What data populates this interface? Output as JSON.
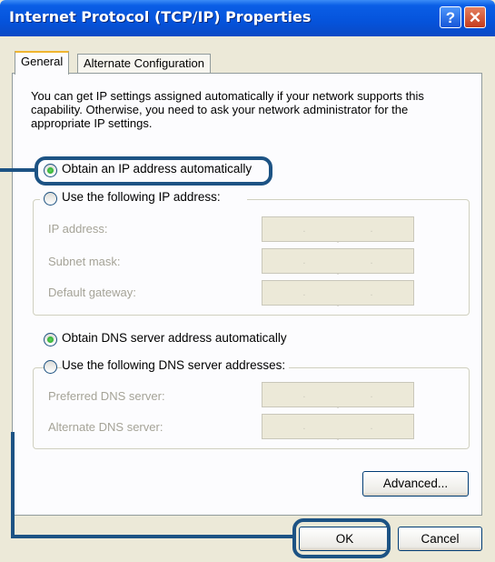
{
  "window": {
    "title": "Internet Protocol (TCP/IP) Properties",
    "help_glyph": "?",
    "close_glyph": "✕"
  },
  "tabs": [
    {
      "label": "General",
      "active": true
    },
    {
      "label": "Alternate Configuration",
      "active": false
    }
  ],
  "description": "You can get IP settings assigned automatically if your network supports this capability. Otherwise, you need to ask your network administrator for the appropriate IP settings.",
  "ip": {
    "auto_label": "Obtain an IP address automatically",
    "auto_selected": true,
    "manual_label": "Use the following IP address:",
    "manual_selected": false,
    "fields": [
      {
        "label": "IP address:",
        "value": ". . ."
      },
      {
        "label": "Subnet mask:",
        "value": ". . ."
      },
      {
        "label": "Default gateway:",
        "value": ". . ."
      }
    ]
  },
  "dns": {
    "auto_label": "Obtain DNS server address automatically",
    "auto_selected": true,
    "manual_label": "Use the following DNS server addresses:",
    "manual_selected": false,
    "fields": [
      {
        "label": "Preferred DNS server:",
        "value": ". . ."
      },
      {
        "label": "Alternate DNS server:",
        "value": ". . ."
      }
    ]
  },
  "buttons": {
    "advanced": "Advanced...",
    "ok": "OK",
    "cancel": "Cancel"
  },
  "colors": {
    "titlebar": "#0553db",
    "dialog_bg": "#ece9d8",
    "highlight": "#1d5384"
  }
}
